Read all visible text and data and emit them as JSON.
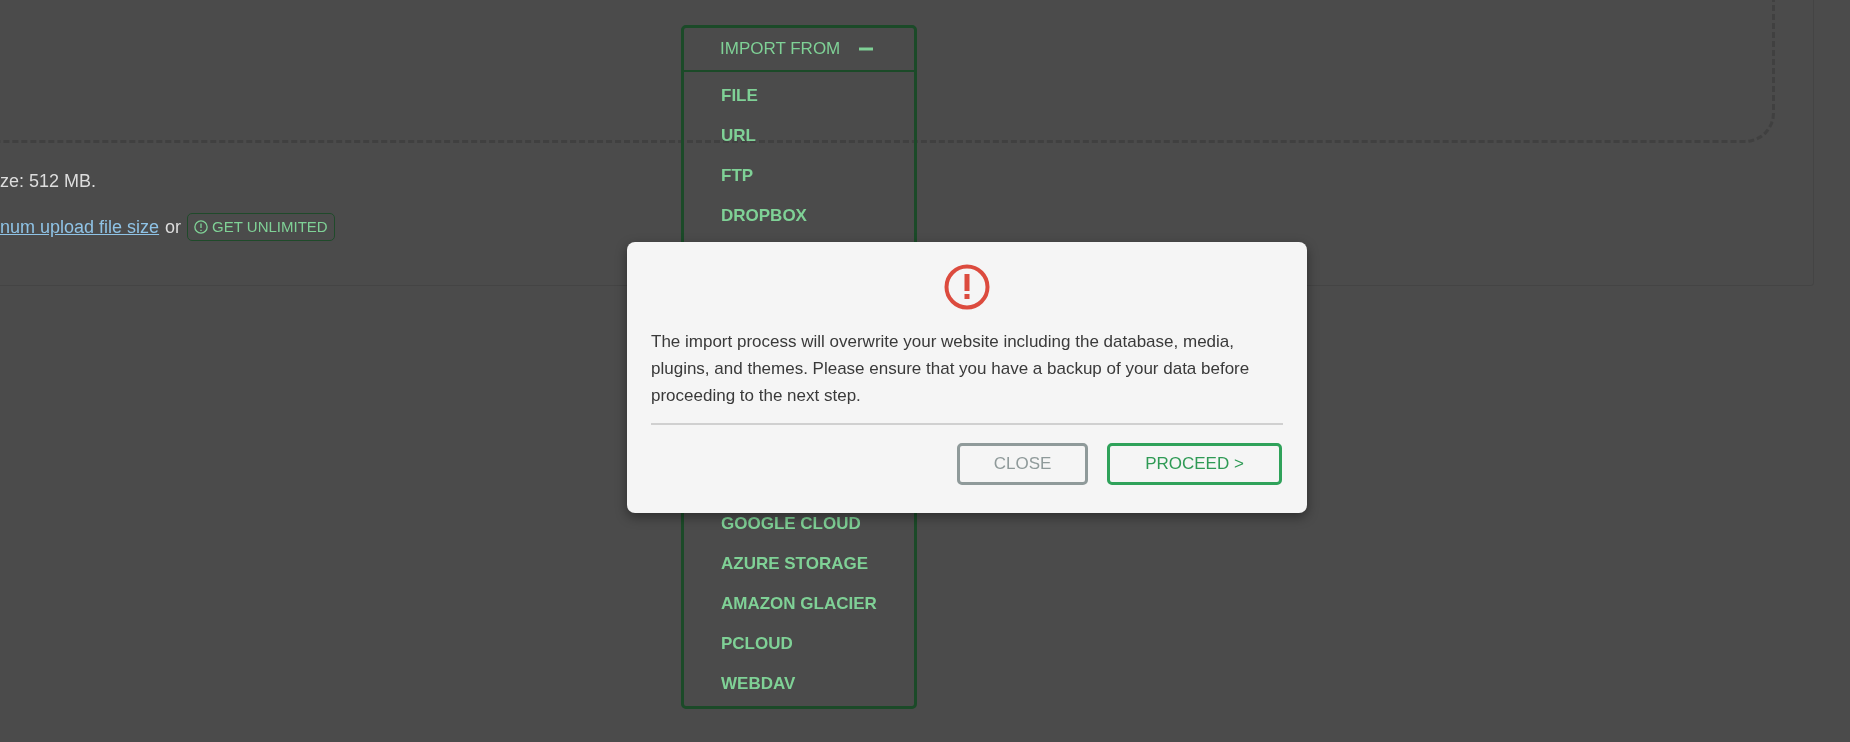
{
  "upload_info": {
    "max_size_text": "ze: 512 MB.",
    "link": "num upload file size",
    "or_text": "or",
    "unlimited_button": "GET UNLIMITED"
  },
  "import_menu": {
    "title": "IMPORT FROM",
    "expanded": true,
    "items_above_dialog": [
      "FILE",
      "URL",
      "FTP",
      "DROPBOX"
    ],
    "items_below_dialog": [
      "GOOGLE CLOUD",
      "AZURE STORAGE",
      "AMAZON GLACIER",
      "PCLOUD",
      "WEBDAV"
    ]
  },
  "dialog": {
    "message": "The import process will overwrite your website including the database, media, plugins, and themes. Please ensure that you have a backup of your data before proceeding to the next step.",
    "buttons": [
      {
        "label": "CLOSE",
        "kind": "secondary"
      },
      {
        "label": "PROCEED >",
        "kind": "primary"
      }
    ]
  }
}
